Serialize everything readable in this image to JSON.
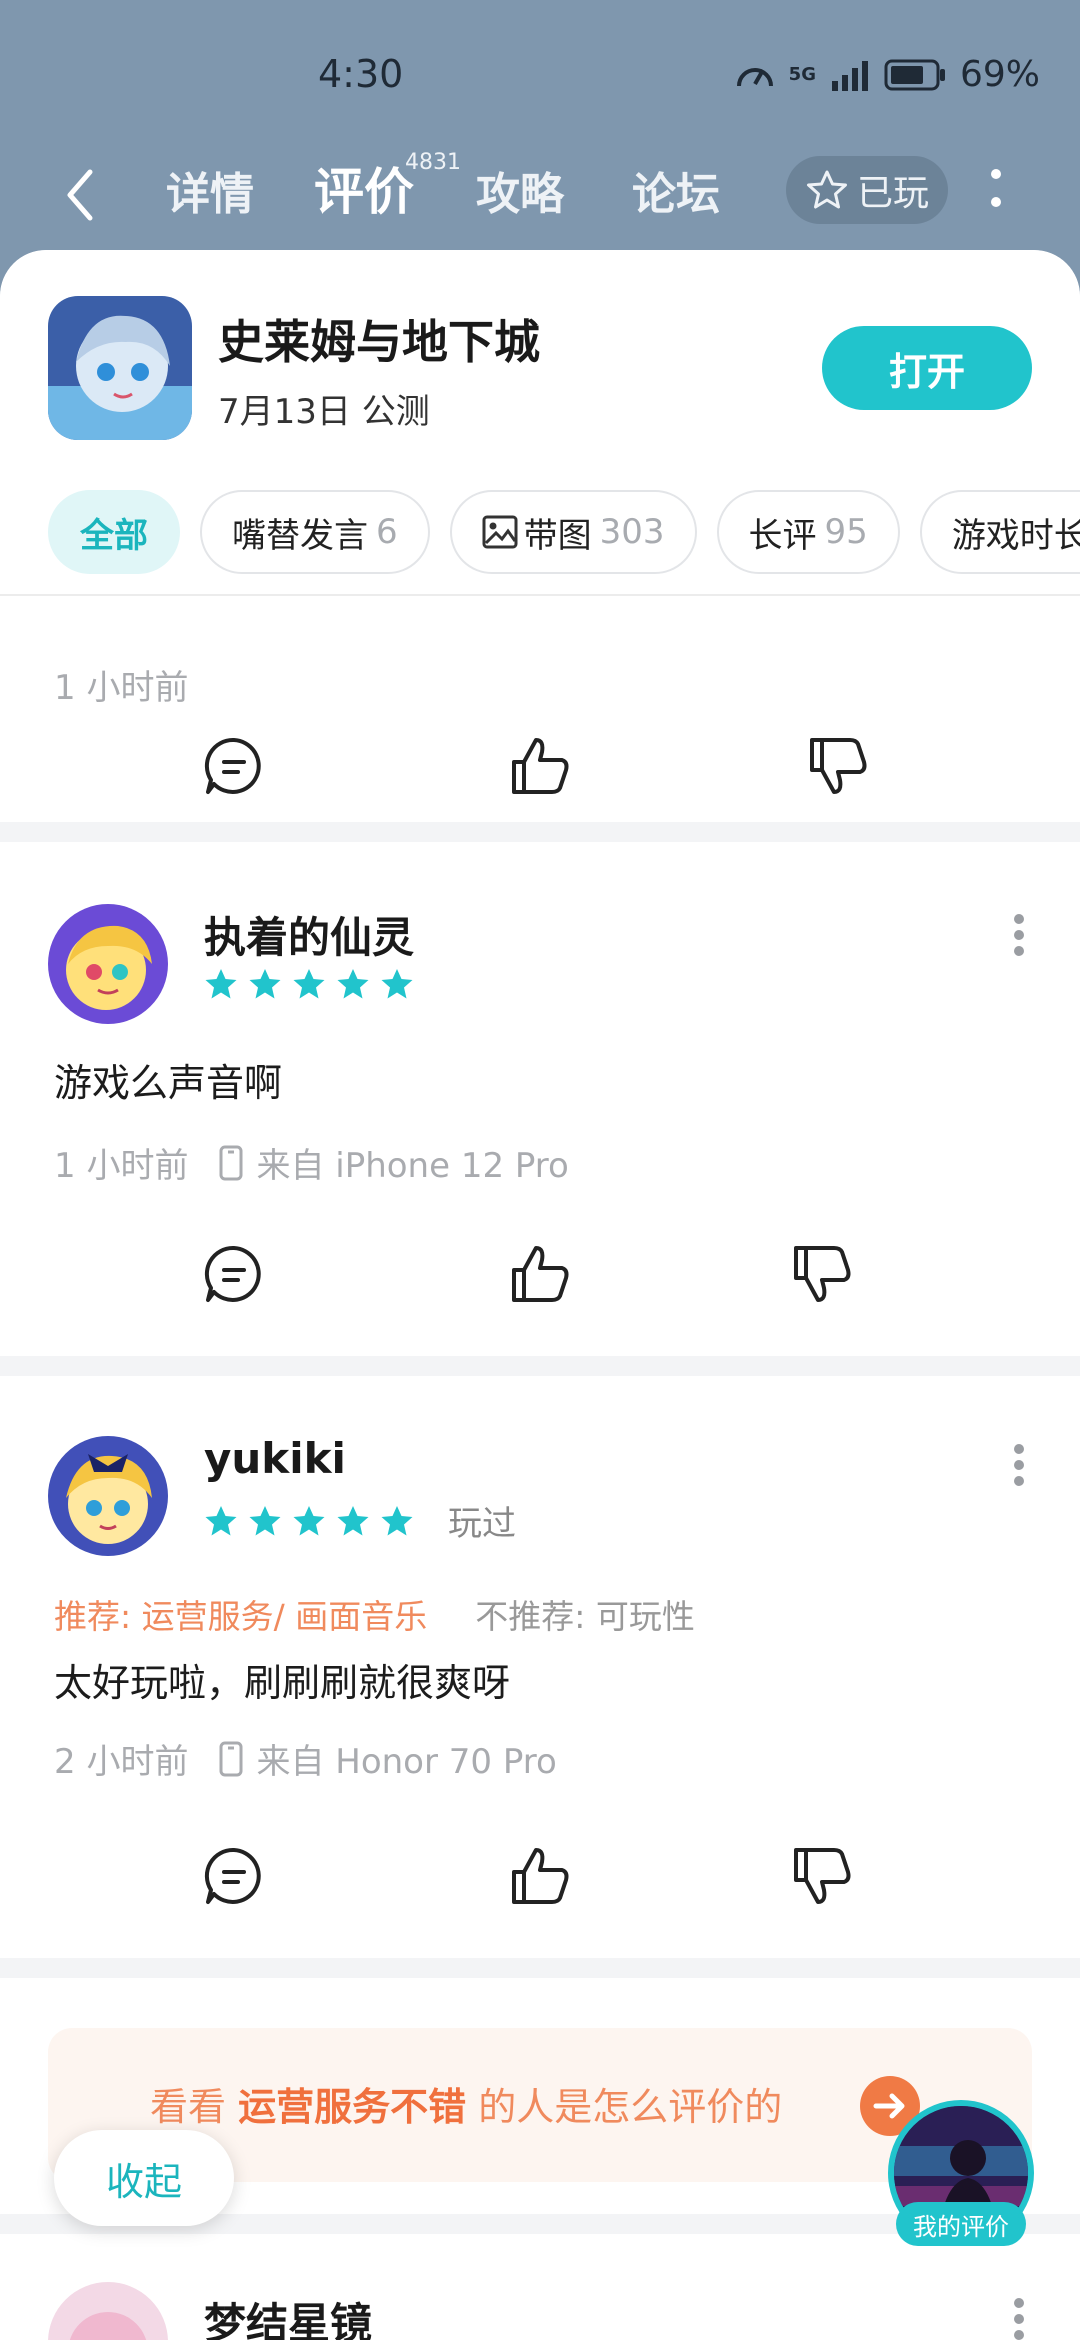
{
  "status_bar": {
    "time": "4:30",
    "network": "5G",
    "battery": "69%"
  },
  "nav": {
    "tabs": [
      {
        "label": "详情"
      },
      {
        "label": "评价"
      },
      {
        "label": "攻略"
      },
      {
        "label": "论坛"
      }
    ],
    "review_count": "4831",
    "played_label": "已玩"
  },
  "app": {
    "name": "史莱姆与地下城",
    "subtitle": "7月13日 公测",
    "open_label": "打开"
  },
  "filters": [
    {
      "label": "全部",
      "count": ""
    },
    {
      "label": "嘴替发言",
      "count": "6"
    },
    {
      "label": "带图",
      "count": "303"
    },
    {
      "label": "长评",
      "count": "95"
    },
    {
      "label": "游戏时长",
      "count": ""
    }
  ],
  "prev_card": {
    "time": "1 小时前"
  },
  "reviews": [
    {
      "user": "执着的仙灵",
      "stars": 5,
      "text": "游戏么声音啊",
      "time": "1 小时前",
      "device": "来自 iPhone 12 Pro"
    },
    {
      "user": "yukiki",
      "stars": 5,
      "played": "玩过",
      "recommend": "推荐: 运营服务/ 画面音乐",
      "not_recommend": "不推荐: 可玩性",
      "text": "太好玩啦，刷刷刷就很爽呀",
      "time": "2 小时前",
      "device": "来自 Honor 70 Pro"
    }
  ],
  "promo": {
    "prefix": "看看 ",
    "highlight": "运营服务不错",
    "suffix": " 的人是怎么评价的"
  },
  "collapse_label": "收起",
  "my_review_label": "我的评价",
  "next_user": "梦结星镜",
  "colors": {
    "accent": "#21c4cc",
    "orange": "#f08a5d",
    "header_bg": "#7f97ae"
  }
}
